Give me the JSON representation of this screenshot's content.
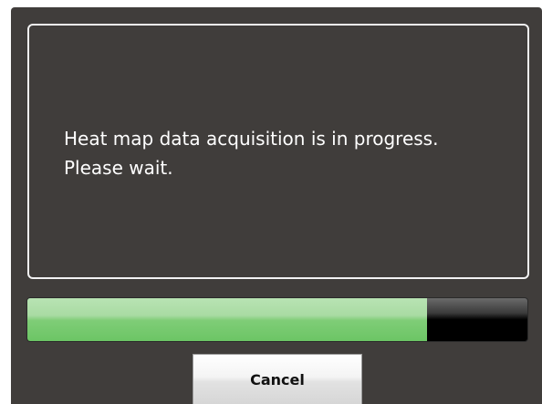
{
  "dialog": {
    "message": "Heat map data acquisition is in progress.\nPlease wait.",
    "progress": 0.8,
    "cancel_label": "Cancel"
  },
  "colors": {
    "dialog_background": "#403d3b",
    "progress_fill": "#7fcd77",
    "progress_track": "#000000"
  }
}
